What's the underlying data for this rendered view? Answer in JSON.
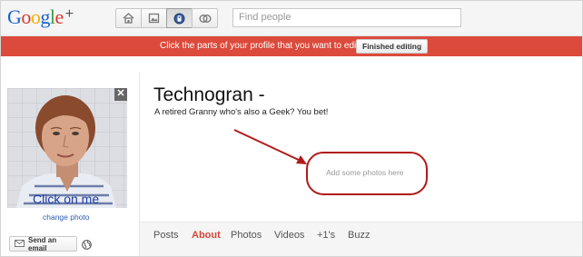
{
  "header": {
    "logo_letters": [
      "G",
      "o",
      "o",
      "g",
      "l",
      "e"
    ],
    "logo_plus": "+",
    "nav_icons": [
      "home-icon",
      "photos-icon",
      "profile-icon",
      "circles-icon"
    ],
    "search": {
      "placeholder": "Find people",
      "value": ""
    }
  },
  "banner": {
    "message": "Click the parts of your profile that you want to edit.",
    "finished_label": "Finished editing",
    "color": "#dc4a3b"
  },
  "profile": {
    "name": "Technogran -",
    "tagline": "A retired Granny who's also a Geek? You bet!",
    "photo_close": "✕",
    "photo_overlay": "Click on me",
    "change_photo": "change photo",
    "send_email": "Send an email",
    "add_photos": "Add some photos here"
  },
  "tabs": [
    {
      "label": "Posts",
      "active": false
    },
    {
      "label": "About",
      "active": true
    },
    {
      "label": "Photos",
      "active": false
    },
    {
      "label": "Videos",
      "active": false
    },
    {
      "label": "+1's",
      "active": false
    },
    {
      "label": "Buzz",
      "active": false
    }
  ],
  "colors": {
    "accent_red": "#d14836",
    "link_blue": "#2a5db0",
    "annotation": "#b21a1a"
  }
}
